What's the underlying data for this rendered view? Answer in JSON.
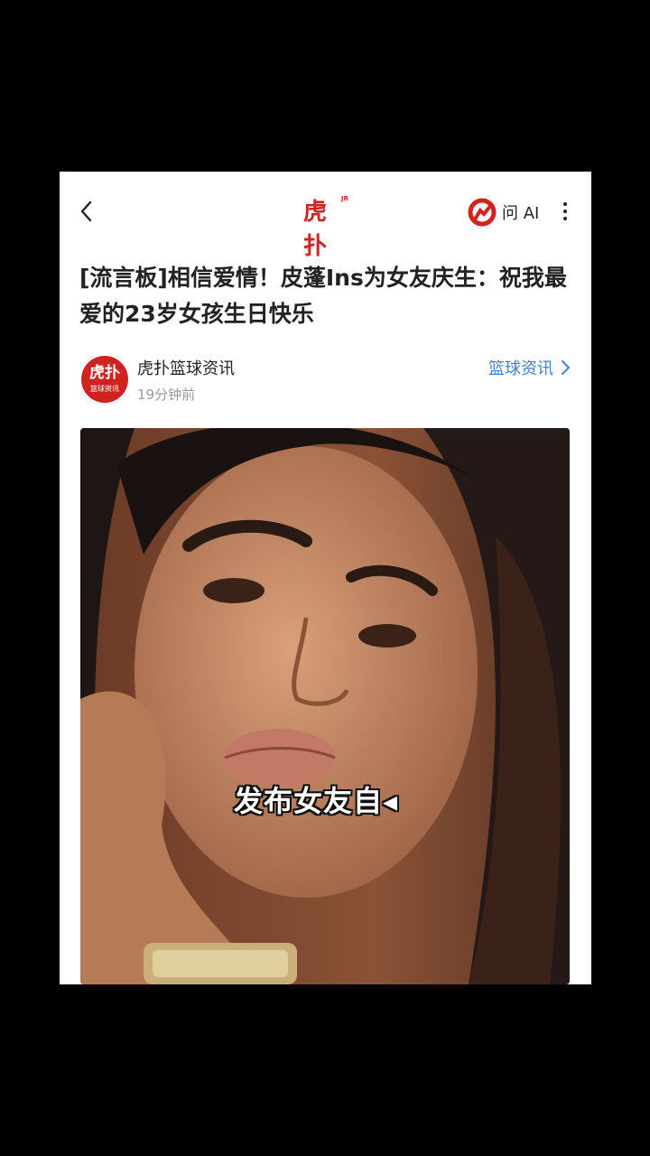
{
  "nav": {
    "brand": "虎扑",
    "brand_sub": "JR",
    "ask_ai_label": "问 AI"
  },
  "article": {
    "title": "[流言板]相信爱情！皮蓬Ins为女友庆生：祝我最爱的23岁女孩生日快乐"
  },
  "source": {
    "avatar_top": "虎扑",
    "avatar_bottom": "篮球资讯",
    "name": "虎扑篮球资讯",
    "time": "19分钟前",
    "category_link": "篮球资讯"
  },
  "video": {
    "caption": "发布女友自◂"
  },
  "colors": {
    "brand_red": "#d0221f",
    "link_blue": "#3f7fd8",
    "background": "#000000"
  }
}
